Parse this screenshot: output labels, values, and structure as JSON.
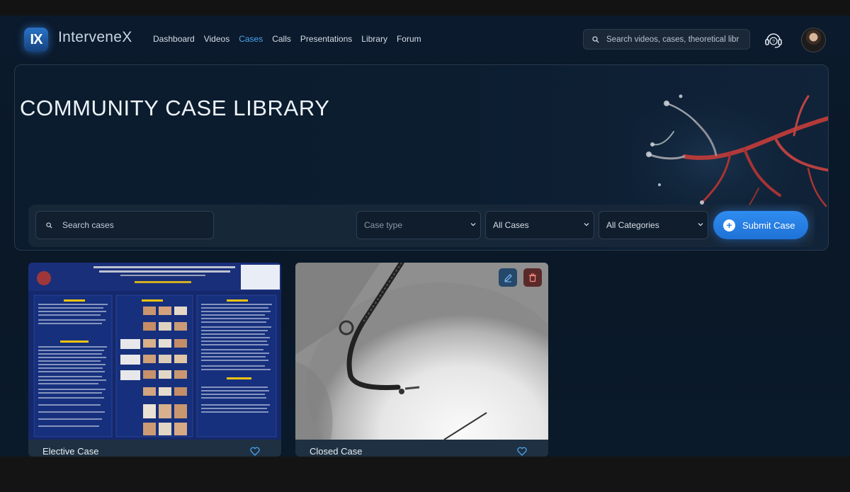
{
  "header": {
    "logo_text": "IX",
    "brand": "IntervenеX",
    "nav": [
      {
        "label": "Dashboard",
        "active": false
      },
      {
        "label": "Videos",
        "active": false
      },
      {
        "label": "Cases",
        "active": true
      },
      {
        "label": "Calls",
        "active": false
      },
      {
        "label": "Presentations",
        "active": false
      },
      {
        "label": "Library",
        "active": false
      },
      {
        "label": "Forum",
        "active": false
      }
    ],
    "search_placeholder": "Search videos, cases, theoretical libr",
    "support_icon": "headset-question-icon",
    "avatar_icon": "user-avatar"
  },
  "hero": {
    "title": "COMMUNITY CASE LIBRARY"
  },
  "filters": {
    "search_placeholder": "Search cases",
    "case_type": "Case type",
    "cases": "All Cases",
    "categories": "All Categories",
    "submit_label": "Submit Case"
  },
  "cards": [
    {
      "title": "Elective Case",
      "thumbnail": "poster"
    },
    {
      "title": "Closed Case",
      "thumbnail": "x-ray",
      "actions": [
        "edit-icon",
        "trash-icon"
      ]
    }
  ],
  "colors": {
    "accent": "#4aa6f0",
    "button": "#2a82e8",
    "background": "#0b1a2c"
  }
}
